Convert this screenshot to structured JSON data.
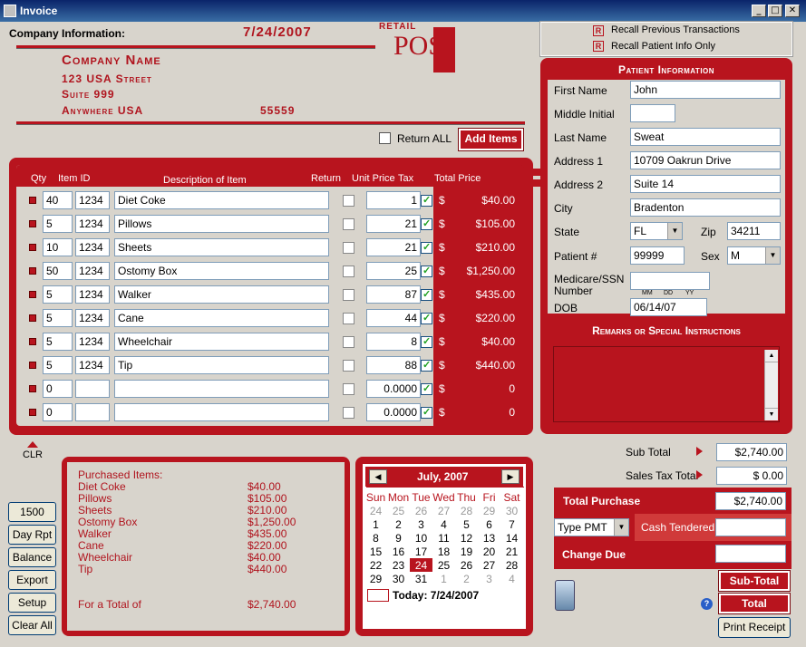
{
  "window": {
    "title": "Invoice"
  },
  "company": {
    "label": "Company Information:",
    "date": "7/24/2007",
    "name": "Company Name",
    "street": "123 USA Street",
    "suite": "Suite 999",
    "city": "Anywhere USA",
    "zip": "55559",
    "logo_top": "RETAIL",
    "logo_main": "POS"
  },
  "recall": {
    "prev": "Recall Previous Transactions",
    "patient": "Recall Patient Info Only",
    "badge": "R"
  },
  "return_all_label": "Return ALL",
  "add_items_label": "Add Items",
  "items_header": {
    "qty": "Qty",
    "item_id": "Item ID",
    "desc": "Description of Item",
    "ret": "Return",
    "unit": "Unit Price",
    "tax": "Tax",
    "total": "Total Price"
  },
  "items": [
    {
      "qty": "40",
      "id": "1234",
      "desc": "Diet Coke",
      "return": false,
      "unit": "1",
      "tax": true,
      "currency": "$",
      "total": "$40.00"
    },
    {
      "qty": "5",
      "id": "1234",
      "desc": "Pillows",
      "return": false,
      "unit": "21",
      "tax": true,
      "currency": "$",
      "total": "$105.00"
    },
    {
      "qty": "10",
      "id": "1234",
      "desc": "Sheets",
      "return": false,
      "unit": "21",
      "tax": true,
      "currency": "$",
      "total": "$210.00"
    },
    {
      "qty": "50",
      "id": "1234",
      "desc": "Ostomy Box",
      "return": false,
      "unit": "25",
      "tax": true,
      "currency": "$",
      "total": "$1,250.00"
    },
    {
      "qty": "5",
      "id": "1234",
      "desc": "Walker",
      "return": false,
      "unit": "87",
      "tax": true,
      "currency": "$",
      "total": "$435.00"
    },
    {
      "qty": "5",
      "id": "1234",
      "desc": "Cane",
      "return": false,
      "unit": "44",
      "tax": true,
      "currency": "$",
      "total": "$220.00"
    },
    {
      "qty": "5",
      "id": "1234",
      "desc": "Wheelchair",
      "return": false,
      "unit": "8",
      "tax": true,
      "currency": "$",
      "total": "$40.00"
    },
    {
      "qty": "5",
      "id": "1234",
      "desc": "Tip",
      "return": false,
      "unit": "88",
      "tax": true,
      "currency": "$",
      "total": "$440.00"
    },
    {
      "qty": "0",
      "id": "",
      "desc": "",
      "return": false,
      "unit": "0.0000",
      "tax": true,
      "currency": "$",
      "total": "0"
    },
    {
      "qty": "0",
      "id": "",
      "desc": "",
      "return": false,
      "unit": "0.0000",
      "tax": true,
      "currency": "$",
      "total": "0"
    }
  ],
  "clr_label": "CLR",
  "summary": {
    "heading": "Purchased Items:",
    "lines": [
      {
        "name": "Diet Coke",
        "amount": "$40.00"
      },
      {
        "name": "Pillows",
        "amount": "$105.00"
      },
      {
        "name": "Sheets",
        "amount": "$210.00"
      },
      {
        "name": "Ostomy Box",
        "amount": "$1,250.00"
      },
      {
        "name": "Walker",
        "amount": "$435.00"
      },
      {
        "name": "Cane",
        "amount": "$220.00"
      },
      {
        "name": "Wheelchair",
        "amount": "$40.00"
      },
      {
        "name": "Tip",
        "amount": "$440.00"
      }
    ],
    "total_label": "For a Total of",
    "total": "$2,740.00"
  },
  "side_buttons": [
    "1500",
    "Day Rpt",
    "Balance",
    "Export",
    "Setup",
    "Clear All"
  ],
  "calendar": {
    "month": "July, 2007",
    "days": [
      "Sun",
      "Mon",
      "Tue",
      "Wed",
      "Thu",
      "Fri",
      "Sat"
    ],
    "weeks": [
      [
        "24",
        "25",
        "26",
        "27",
        "28",
        "29",
        "30"
      ],
      [
        "1",
        "2",
        "3",
        "4",
        "5",
        "6",
        "7"
      ],
      [
        "8",
        "9",
        "10",
        "11",
        "12",
        "13",
        "14"
      ],
      [
        "15",
        "16",
        "17",
        "18",
        "19",
        "20",
        "21"
      ],
      [
        "22",
        "23",
        "24",
        "25",
        "26",
        "27",
        "28"
      ],
      [
        "29",
        "30",
        "31",
        "1",
        "2",
        "3",
        "4"
      ]
    ],
    "today_label": "Today: 7/24/2007"
  },
  "patient": {
    "heading": "Patient Information",
    "first_name_label": "First Name",
    "first_name": "John",
    "middle_label": "Middle Initial",
    "middle": "",
    "last_name_label": "Last Name",
    "last_name": "Sweat",
    "addr1_label": "Address 1",
    "addr1": "10709 Oakrun Drive",
    "addr2_label": "Address 2",
    "addr2": "Suite 14",
    "city_label": "City",
    "city": "Bradenton",
    "state_label": "State",
    "state": "FL",
    "zip_label": "Zip",
    "zip": "34211",
    "patient_no_label": "Patient #",
    "patient_no": "99999",
    "sex_label": "Sex",
    "sex": "M",
    "medicare_label1": "Medicare/SSN",
    "medicare_label2": "Number",
    "medicare": "",
    "dob_hint_mm": "MM",
    "dob_hint_dd": "DD",
    "dob_hint_yy": "YY",
    "dob_label": "DOB",
    "dob": "06/14/07",
    "remarks_heading": "Remarks or Special Instructions"
  },
  "totals": {
    "subtotal_label": "Sub Total",
    "subtotal": "$2,740.00",
    "tax_label": "Sales Tax Total",
    "tax": "$ 0.00",
    "purchase_label": "Total Purchase",
    "purchase": "$2,740.00",
    "pmt_type": "Type PMT",
    "cash_label": "Cash Tendered",
    "cash": "",
    "change_label": "Change Due",
    "change": ""
  },
  "actions": {
    "subtotal": "Sub-Total",
    "total": "Total",
    "print": "Print Receipt",
    "help": "?"
  }
}
